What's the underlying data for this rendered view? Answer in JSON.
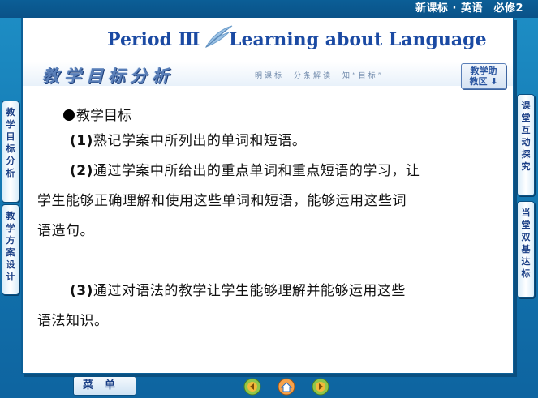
{
  "header": {
    "course_title": "新课标 · 英语　必修2"
  },
  "slide": {
    "title_left": "Period Ⅲ",
    "title_right": "Learning about Language",
    "banner_heading": "教学目标分析",
    "banner_motto": "明课标　分条解读　知“目标”",
    "assist_button": {
      "line1": "教学助",
      "line2": "教区 ⬇"
    },
    "bullet_heading": "教学目标",
    "items": [
      {
        "num": "(1)",
        "text": "熟记学案中所列出的单词和短语。"
      },
      {
        "num": "(2)",
        "line1": "通过学案中所给出的重点单词和重点短语的学习，让",
        "line2": "学生能够正确理解和使用这些单词和短语，能够运用这些词",
        "line3": "语造句。"
      },
      {
        "num": "(3)",
        "line1": "通过对语法的教学让学生能够理解并能够运用这些",
        "line2": "语法知识。"
      }
    ]
  },
  "left_tabs": [
    {
      "label": "教学目标分析"
    },
    {
      "label": "教学方案设计"
    }
  ],
  "right_tabs": [
    {
      "label": "课堂互动探究"
    },
    {
      "label": "当堂双基达标"
    }
  ],
  "footer": {
    "menu_label": "菜单"
  },
  "colors": {
    "background": "#1479b3",
    "title": "#1b4aa3",
    "accent": "#5a7fb8"
  }
}
